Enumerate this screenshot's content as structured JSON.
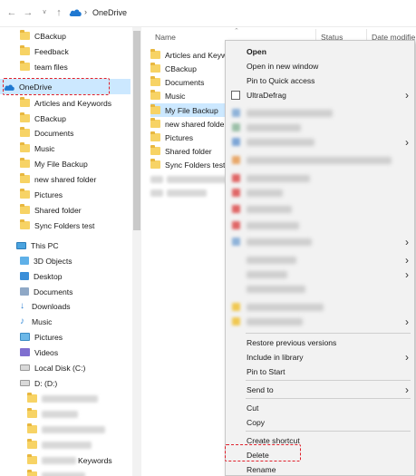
{
  "address_bar": {
    "location": "OneDrive",
    "back_icon": "arrow-left-icon",
    "forward_icon": "arrow-right-icon",
    "recent_icon": "chevron-down-icon",
    "up_icon": "arrow-up-icon"
  },
  "nav_pane": {
    "items": [
      {
        "label": "CBackup",
        "icon": "folder-icon"
      },
      {
        "label": "Feedback",
        "icon": "folder-icon"
      },
      {
        "label": "team files",
        "icon": "folder-icon"
      },
      {
        "label": "OneDrive",
        "icon": "onedrive-cloud-icon"
      },
      {
        "label": "Articles and Keywords",
        "icon": "folder-icon"
      },
      {
        "label": "CBackup",
        "icon": "folder-icon"
      },
      {
        "label": "Documents",
        "icon": "folder-icon"
      },
      {
        "label": "Music",
        "icon": "folder-icon"
      },
      {
        "label": "My File Backup",
        "icon": "folder-icon"
      },
      {
        "label": "new shared folder",
        "icon": "folder-icon"
      },
      {
        "label": "Pictures",
        "icon": "folder-icon"
      },
      {
        "label": "Shared folder",
        "icon": "folder-icon"
      },
      {
        "label": "Sync Folders test",
        "icon": "folder-icon"
      },
      {
        "label": "This PC",
        "icon": "computer-icon"
      },
      {
        "label": "3D Objects",
        "icon": "3d-objects-icon"
      },
      {
        "label": "Desktop",
        "icon": "desktop-icon"
      },
      {
        "label": "Documents",
        "icon": "documents-icon"
      },
      {
        "label": "Downloads",
        "icon": "downloads-icon"
      },
      {
        "label": "Music",
        "icon": "music-icon"
      },
      {
        "label": "Pictures",
        "icon": "pictures-icon"
      },
      {
        "label": "Videos",
        "icon": "videos-icon"
      },
      {
        "label": "Local Disk (C:)",
        "icon": "drive-icon"
      },
      {
        "label": "D: (D:)",
        "icon": "drive-icon"
      },
      {
        "label": "",
        "icon": "folder-icon"
      },
      {
        "label": "",
        "icon": "folder-icon"
      },
      {
        "label": "",
        "icon": "folder-icon"
      },
      {
        "label": "",
        "icon": "folder-icon"
      },
      {
        "label": "",
        "icon": "folder-icon"
      },
      {
        "label": "",
        "icon": "folder-icon"
      },
      {
        "label": "Keywords",
        "icon": "folder-icon"
      }
    ]
  },
  "file_list": {
    "columns": {
      "name": "Name",
      "status": "Status",
      "date": "Date modifie"
    },
    "rows": [
      {
        "label": "Articles and Keyw",
        "icon": "folder-icon"
      },
      {
        "label": "CBackup",
        "icon": "folder-icon"
      },
      {
        "label": "Documents",
        "icon": "folder-icon"
      },
      {
        "label": "Music",
        "icon": "folder-icon"
      },
      {
        "label": "My File Backup",
        "icon": "folder-icon"
      },
      {
        "label": "new shared folde",
        "icon": "folder-icon"
      },
      {
        "label": "Pictures",
        "icon": "folder-icon"
      },
      {
        "label": "Shared folder",
        "icon": "folder-icon"
      },
      {
        "label": "Sync Folders test",
        "icon": "folder-icon"
      }
    ]
  },
  "context_menu": {
    "open": "Open",
    "open_new_window": "Open in new window",
    "pin_quick_access": "Pin to Quick access",
    "ultradefrag": "UltraDefrag",
    "restore_versions": "Restore previous versions",
    "include_library": "Include in library",
    "pin_start": "Pin to Start",
    "send_to": "Send to",
    "cut": "Cut",
    "copy": "Copy",
    "create_shortcut": "Create shortcut",
    "delete": "Delete",
    "rename": "Rename"
  },
  "colors": {
    "selection": "#cce8ff",
    "highlight_dash": "#e0202b",
    "menu_bg": "#f2f2f2",
    "folder": "#f7d365",
    "onedrive_blue": "#1f78d1"
  }
}
